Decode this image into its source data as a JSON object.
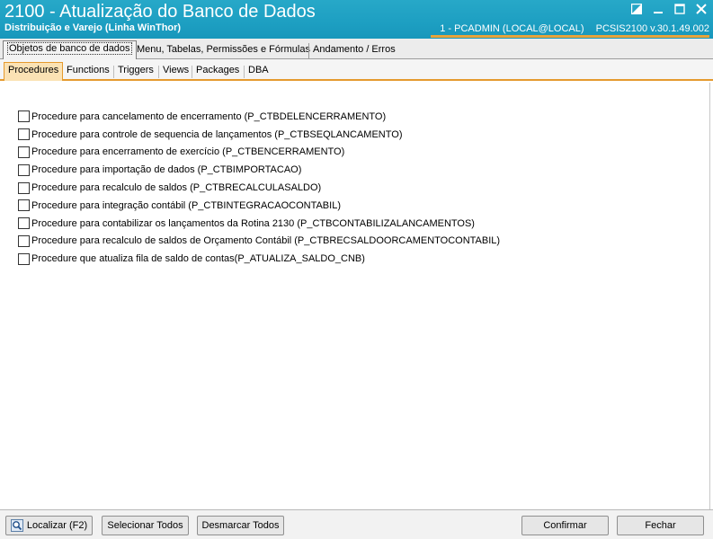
{
  "window": {
    "title": "2100 - Atualização do Banco de Dados",
    "subtitle": "Distribuição e Varejo (Linha WinThor)",
    "user_info": "1 - PCADMIN (LOCAL@LOCAL)",
    "version_info": "PCSIS2100  v.30.1.49.002",
    "accent_color": "#e59a2e",
    "titlebar_color": "#1d9fc2"
  },
  "main_tabs": [
    {
      "label": "Objetos de banco de dados",
      "active": true
    },
    {
      "label": "Menu, Tabelas, Permissões e Fórmulas",
      "active": false
    },
    {
      "label": "Andamento / Erros",
      "active": false
    }
  ],
  "sub_tabs": [
    {
      "label": "Procedures",
      "active": true
    },
    {
      "label": "Functions",
      "active": false
    },
    {
      "label": "Triggers",
      "active": false
    },
    {
      "label": "Views",
      "active": false
    },
    {
      "label": "Packages",
      "active": false
    },
    {
      "label": "DBA",
      "active": false
    }
  ],
  "procedures": [
    {
      "label": "Procedure para cancelamento de encerramento (P_CTBDELENCERRAMENTO)",
      "checked": false
    },
    {
      "label": "Procedure para controle de sequencia de lançamentos (P_CTBSEQLANCAMENTO)",
      "checked": false
    },
    {
      "label": "Procedure para encerramento de exercício (P_CTBENCERRAMENTO)",
      "checked": false
    },
    {
      "label": "Procedure para importação de dados (P_CTBIMPORTACAO)",
      "checked": false
    },
    {
      "label": "Procedure para recalculo de saldos (P_CTBRECALCULASALDO)",
      "checked": false
    },
    {
      "label": "Procedure para integração contábil (P_CTBINTEGRACAOCONTABIL)",
      "checked": false
    },
    {
      "label": "Procedure para contabilizar os lançamentos da Rotina 2130 (P_CTBCONTABILIZALANCAMENTOS)",
      "checked": false
    },
    {
      "label": "Procedure para recalculo de saldos de Orçamento Contábil (P_CTBRECSALDOORCAMENTOCONTABIL)",
      "checked": false
    },
    {
      "label": "Procedure que atualiza fila de saldo de contas(P_ATUALIZA_SALDO_CNB)",
      "checked": false
    }
  ],
  "buttons": {
    "localizar": "Localizar (F2)",
    "selecionar_todos": "Selecionar Todos",
    "desmarcar_todos": "Desmarcar Todos",
    "confirmar": "Confirmar",
    "fechar": "Fechar"
  },
  "icons": {
    "restore": "restore-icon",
    "minimize": "minimize-icon",
    "maximize": "maximize-icon",
    "close": "close-icon",
    "search": "magnifier-icon"
  }
}
